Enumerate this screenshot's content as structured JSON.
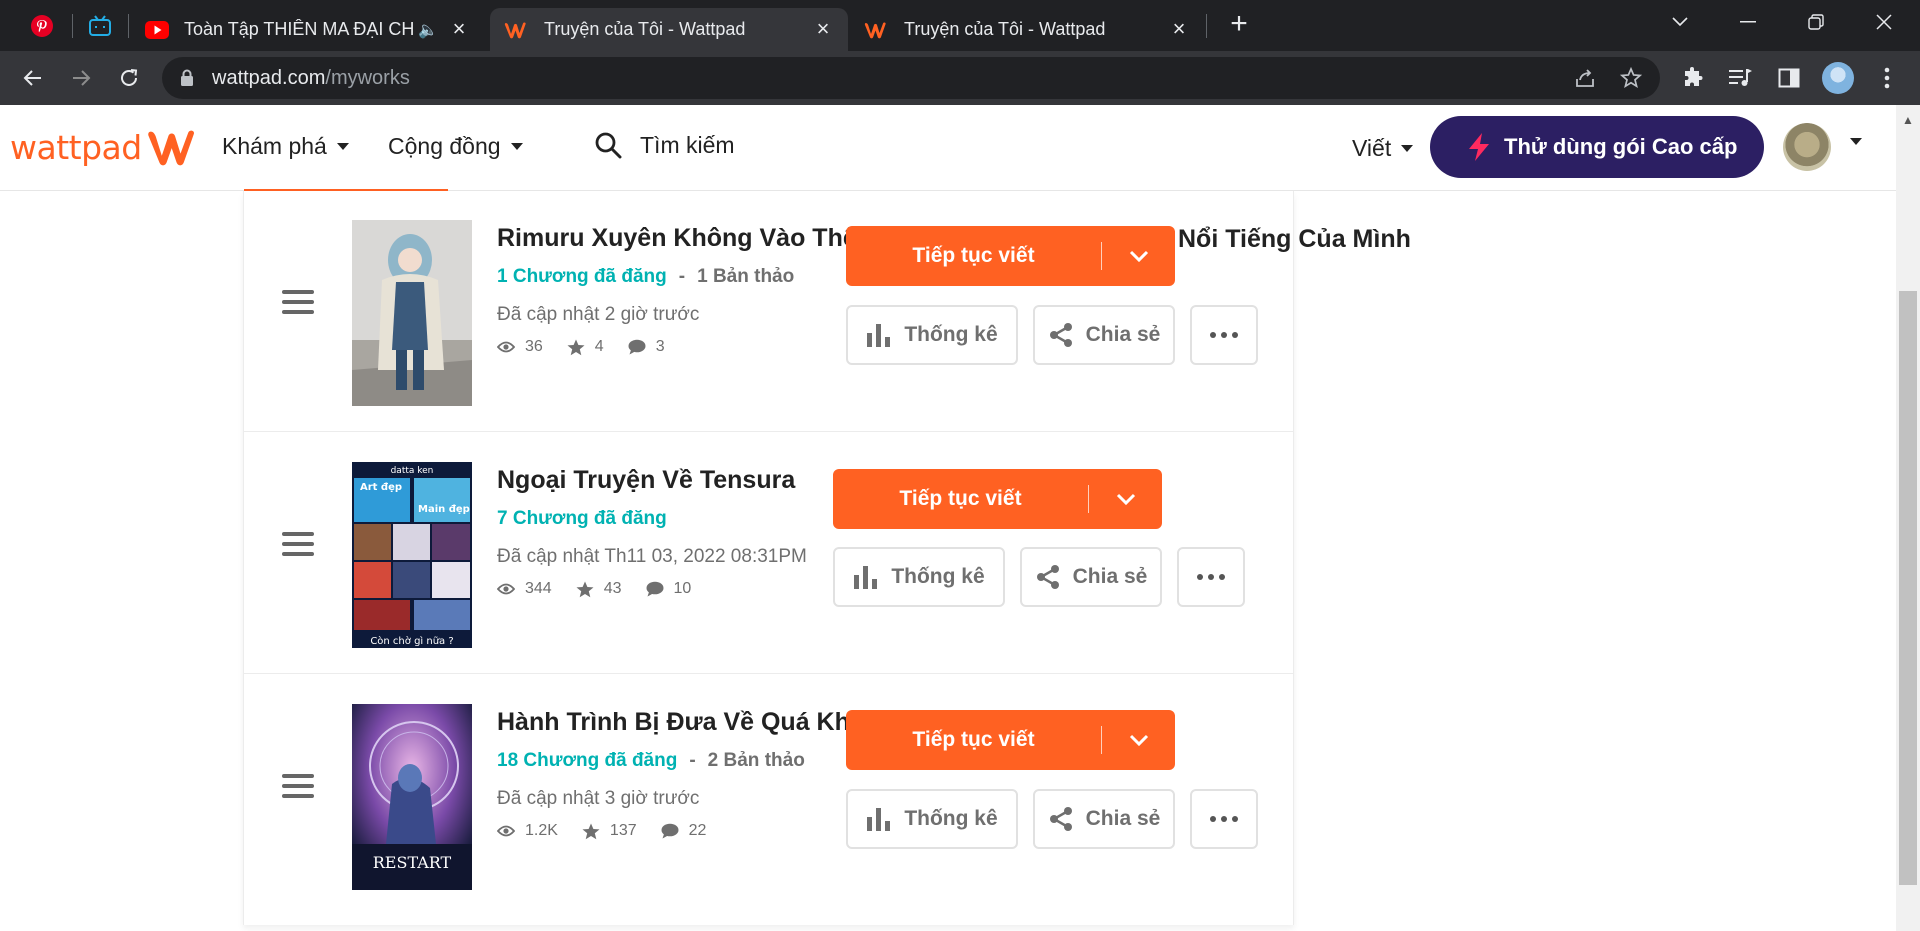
{
  "browser": {
    "tabs": [
      {
        "title": "Toàn Tập THIÊN MA ĐẠI CHIẾN",
        "favicon": "youtube-icon",
        "audio": true
      },
      {
        "title": "Truyện của Tôi - Wattpad",
        "favicon": "wattpad-icon",
        "active": true
      },
      {
        "title": "Truyện của Tôi - Wattpad",
        "favicon": "wattpad-icon"
      }
    ],
    "pinned": [
      "pinterest-icon",
      "bilibili-icon"
    ],
    "url_host": "wattpad.com",
    "url_path": "/myworks"
  },
  "header": {
    "logo_text": "wattpad",
    "nav_discover": "Khám phá",
    "nav_community": "Cộng đồng",
    "search_label": "Tìm kiếm",
    "write_label": "Viết",
    "premium_label": "Thử dùng gói Cao cấp",
    "brand_color": "#ff6122",
    "premium_color": "#2c1f63"
  },
  "buttons": {
    "continue": "Tiếp tục viết",
    "stats": "Thống kê",
    "share": "Chia sẻ"
  },
  "title_overflow_text": "Nổi Tiếng Của Mình",
  "stories": [
    {
      "title": "Rimuru Xuyên Không Vào Thế",
      "published": "1 Chương đã đăng",
      "drafts": "1 Bản thảo",
      "updated": "Đã cập nhật 2 giờ trước",
      "reads": "36",
      "votes": "4",
      "comments": "3"
    },
    {
      "title": "Ngoại Truyện Về Tensura",
      "published": "7 Chương đã đăng",
      "drafts": "",
      "updated": "Đã cập nhật Th11 03, 2022 08:31PM",
      "reads": "344",
      "votes": "43",
      "comments": "10",
      "cover_texts": [
        "datta ken",
        "Art đẹp",
        "Main đẹp",
        "Còn chờ gì nữa ?"
      ]
    },
    {
      "title": "Hành Trình Bị Đưa Về Quá Khứ",
      "published": "18 Chương đã đăng",
      "drafts": "2 Bản thảo",
      "updated": "Đã cập nhật 3 giờ trước",
      "reads": "1.2K",
      "votes": "137",
      "comments": "22",
      "cover_texts": [
        "RESTART"
      ]
    }
  ]
}
